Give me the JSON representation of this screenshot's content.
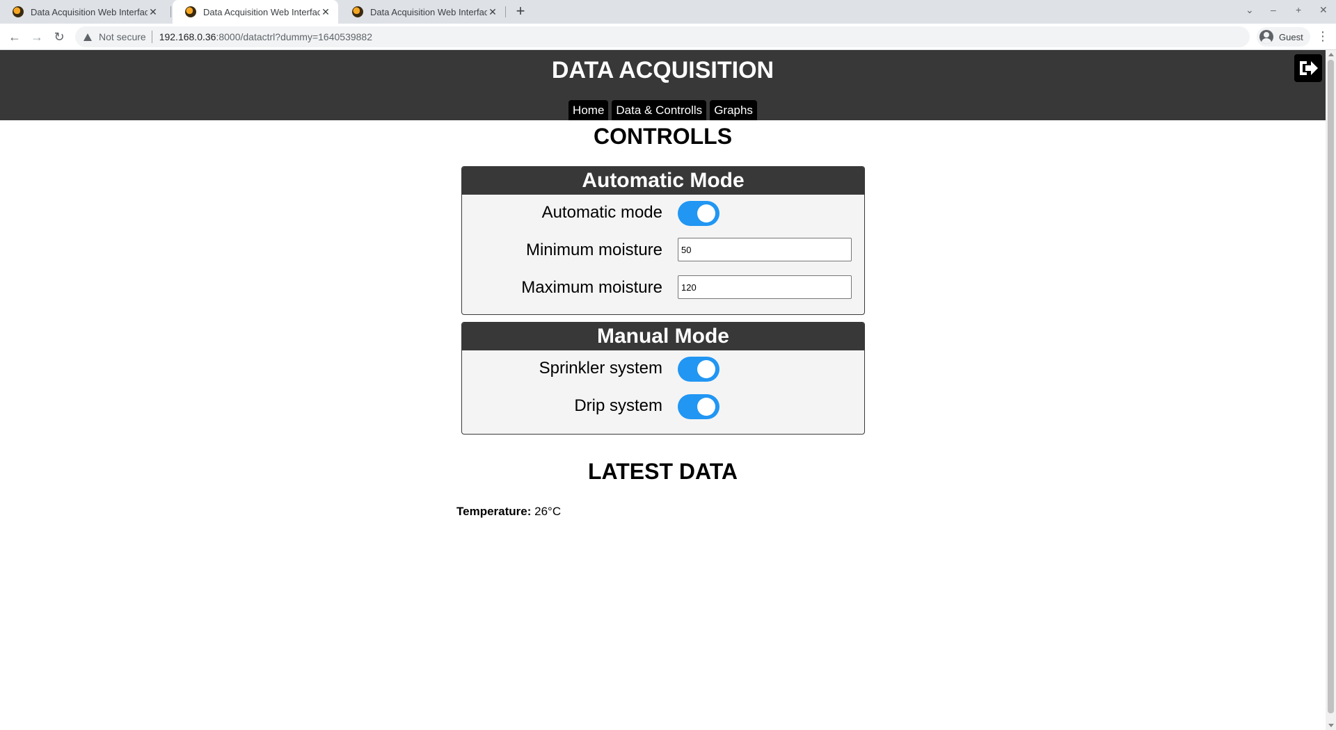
{
  "browser": {
    "tabs": [
      {
        "title": "Data Acquisition Web Interface"
      },
      {
        "title": "Data Acquisition Web Interface"
      },
      {
        "title": "Data Acquisition Web Interface"
      }
    ],
    "security_label": "Not secure",
    "url_host": "192.168.0.36",
    "url_path": ":8000/datactrl?dummy=1640539882",
    "profile_label": "Guest"
  },
  "site": {
    "title": "DATA ACQUISITION",
    "nav": [
      "Home",
      "Data & Controlls",
      "Graphs"
    ]
  },
  "controls": {
    "heading": "CONTROLLS",
    "automatic": {
      "title": "Automatic Mode",
      "auto_label": "Automatic mode",
      "auto_on": true,
      "min_label": "Minimum moisture",
      "min_value": "50",
      "max_label": "Maximum moisture",
      "max_value": "120"
    },
    "manual": {
      "title": "Manual Mode",
      "sprinkler_label": "Sprinkler system",
      "sprinkler_on": true,
      "drip_label": "Drip system",
      "drip_on": true
    }
  },
  "latest": {
    "heading": "LATEST DATA",
    "temp_label": "Temperature:",
    "temp_value": "26°C"
  },
  "colors": {
    "header_bg": "#383838",
    "toggle_on": "#2196f3"
  }
}
